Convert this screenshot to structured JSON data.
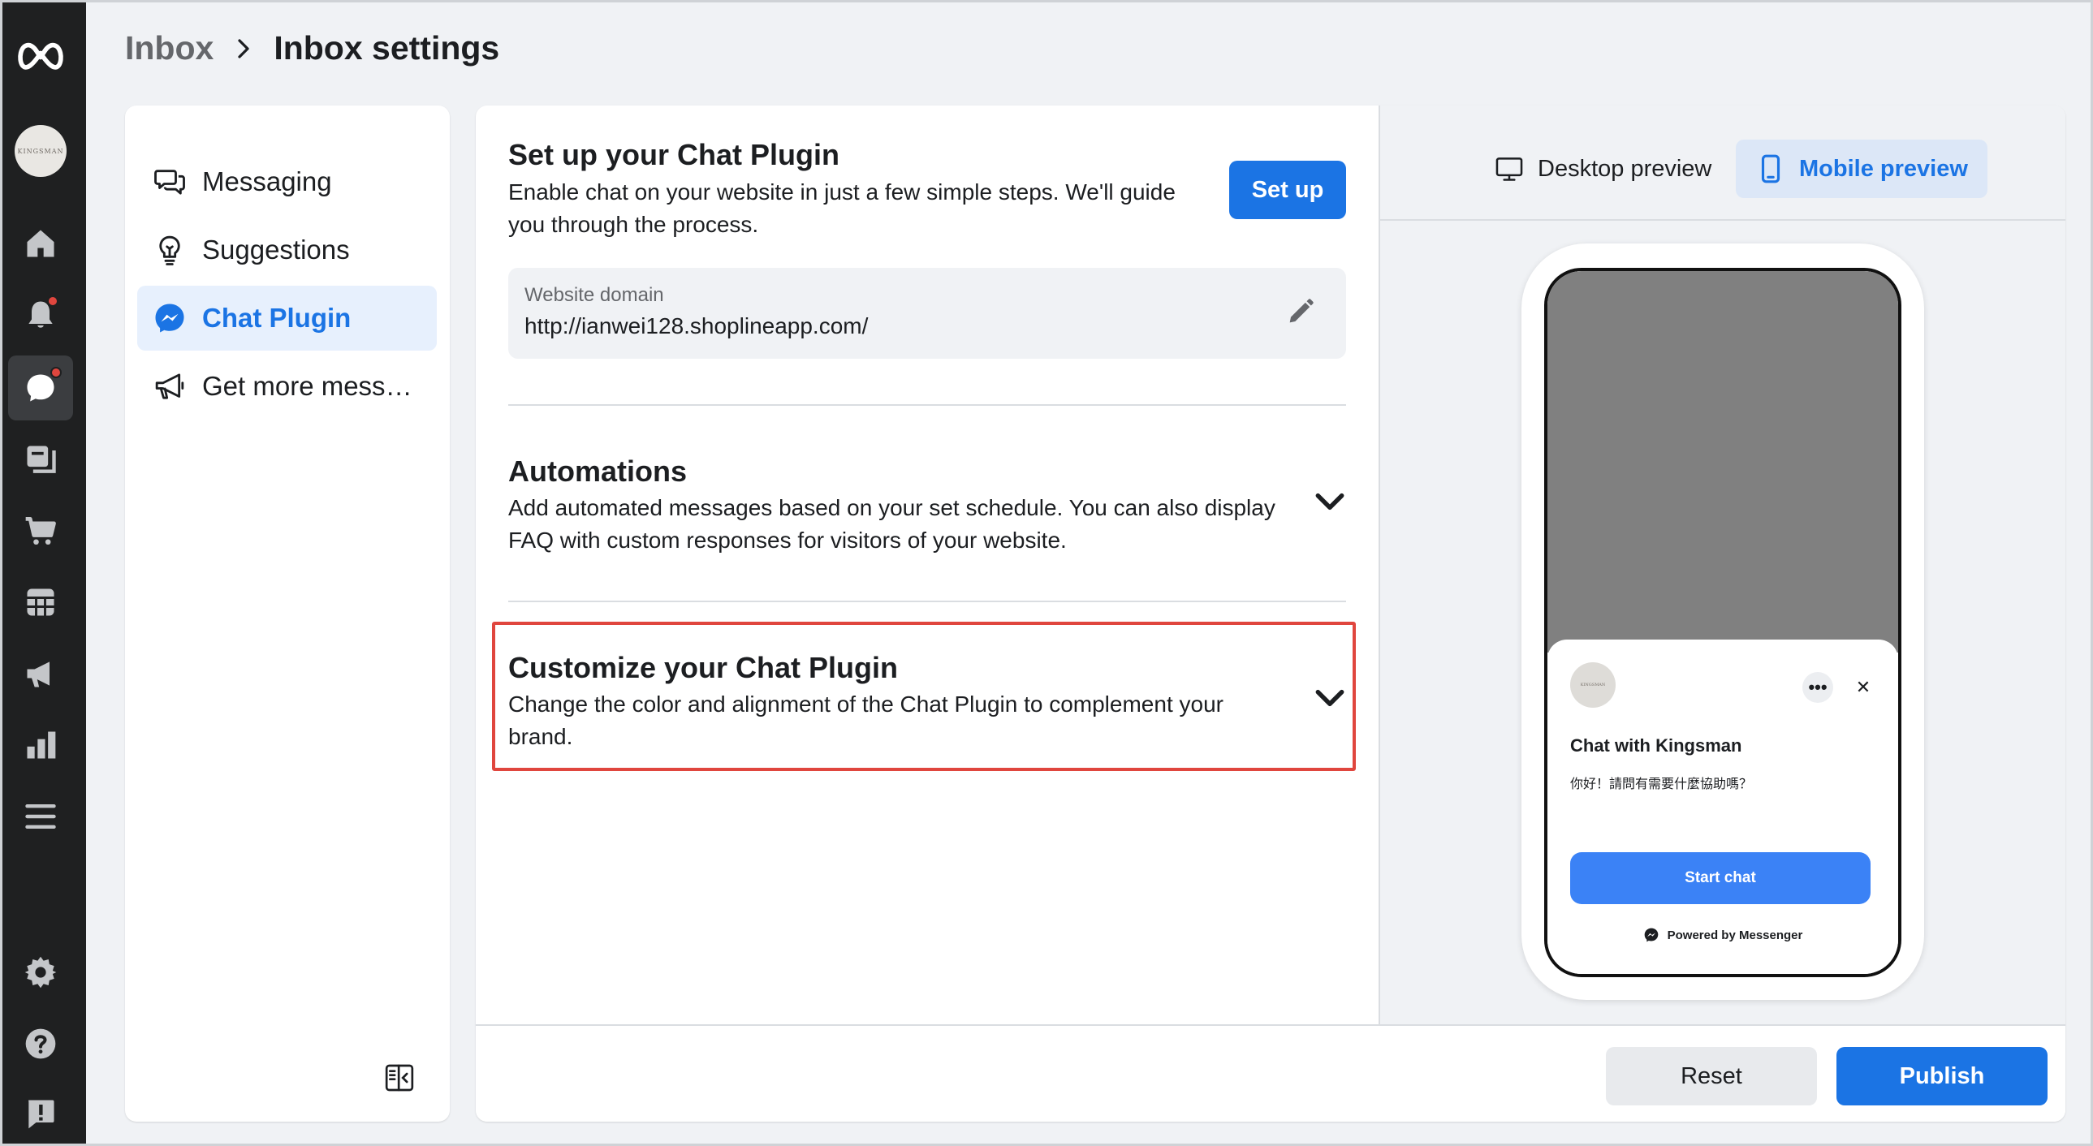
{
  "nav": {
    "logo": "meta-logo-icon",
    "avatar_text": "KINGSMAN",
    "items": [
      "home-icon",
      "notifications-icon",
      "inbox-icon",
      "content-icon",
      "commerce-icon",
      "ads-manager-icon",
      "ads-icon",
      "insights-icon",
      "all-tools-icon"
    ],
    "bottom_items": [
      "settings-icon",
      "help-icon",
      "report-problem-icon"
    ]
  },
  "breadcrumb": {
    "parent": "Inbox",
    "current": "Inbox settings"
  },
  "sidebar": {
    "items": [
      {
        "label": "Messaging",
        "icon": "chat-bubbles-icon"
      },
      {
        "label": "Suggestions",
        "icon": "lightbulb-icon"
      },
      {
        "label": "Chat Plugin",
        "icon": "messenger-icon",
        "active": true
      },
      {
        "label": "Get more messages",
        "icon": "megaphone-icon"
      }
    ]
  },
  "setup": {
    "title": "Set up your Chat Plugin",
    "description": "Enable chat on your website in just a few simple steps. We'll guide you through the process.",
    "button": "Set up",
    "domain_label": "Website domain",
    "domain_value": "http://ianwei128.shoplineapp.com/"
  },
  "automations": {
    "title": "Automations",
    "description": "Add automated messages based on your set schedule. You can also display FAQ with custom responses for visitors of your website."
  },
  "customize": {
    "title": "Customize your Chat Plugin",
    "description": "Change the color and alignment of the Chat Plugin to complement your brand."
  },
  "preview": {
    "desktop_tab": "Desktop preview",
    "mobile_tab": "Mobile preview",
    "avatar_text": "KINGSMAN",
    "more": "•••",
    "close": "✕",
    "chat_title": "Chat with Kingsman",
    "greeting": "你好！請問有需要什麼協助嗎？",
    "start_button": "Start chat",
    "powered_by": "Powered by Messenger"
  },
  "footer": {
    "reset": "Reset",
    "publish": "Publish"
  },
  "colors": {
    "accent": "#1b74e4",
    "highlight_border": "#e0463e",
    "rail_bg": "#1f2021"
  }
}
